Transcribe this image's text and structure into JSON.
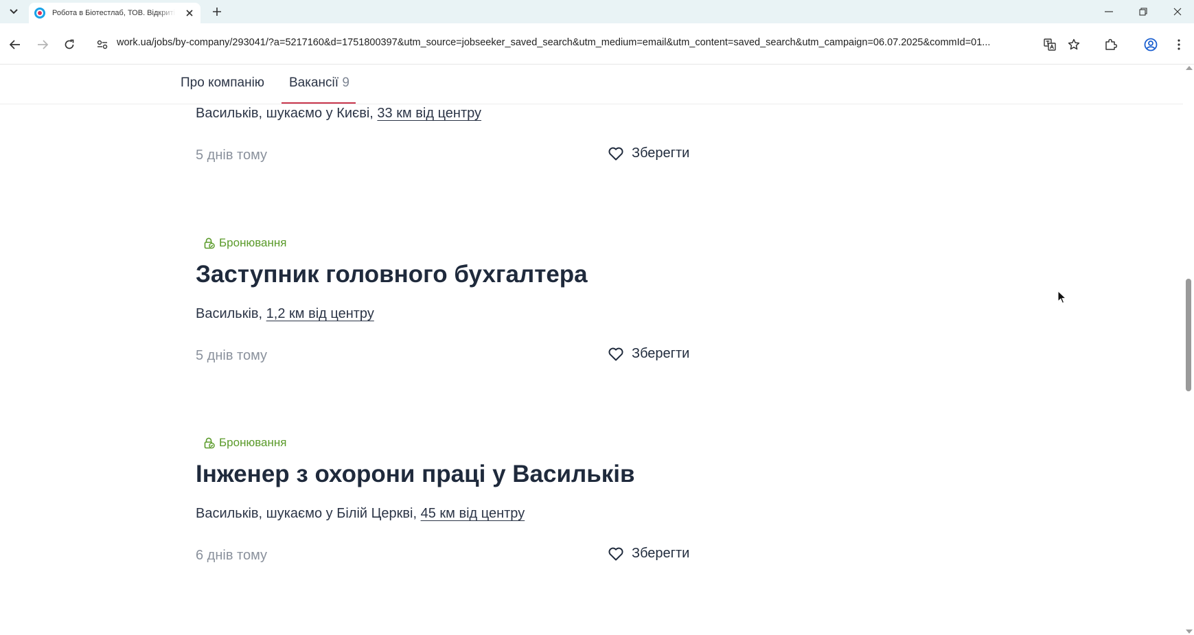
{
  "browser": {
    "tab_title": "Робота в Біотестлаб, ТОВ. Відкриті вакансії",
    "url": "work.ua/jobs/by-company/293041/?a=5217160&d=1751800397&utm_source=jobseeker_saved_search&utm_medium=email&utm_content=saved_search&utm_campaign=06.07.2025&commId=01..."
  },
  "company_nav": {
    "about": "Про компанію",
    "vacancies": "Вакансії",
    "vacancies_count": "9"
  },
  "jobs": [
    {
      "location_prefix": "Васильків, шукаємо у Києві, ",
      "distance": "33 км від центру",
      "date": "5 днів тому",
      "save": "Зберегти"
    },
    {
      "badge": "Бронювання",
      "title": "Заступник головного бухгалтера",
      "location_prefix": "Васильків, ",
      "distance": "1,2 км від центру",
      "date": "5 днів тому",
      "save": "Зберегти"
    },
    {
      "badge": "Бронювання",
      "title": "Інженер з охорони праці у Васильків",
      "location_prefix": "Васильків, шукаємо у Білій Церкві, ",
      "distance": "45 км від центру",
      "date": "6 днів тому",
      "save": "Зберегти"
    }
  ],
  "colors": {
    "badge_green": "#5a9a2a",
    "active_underline": "#c8354b",
    "title_text": "#1f2a3c",
    "muted_text": "#8a919c"
  }
}
